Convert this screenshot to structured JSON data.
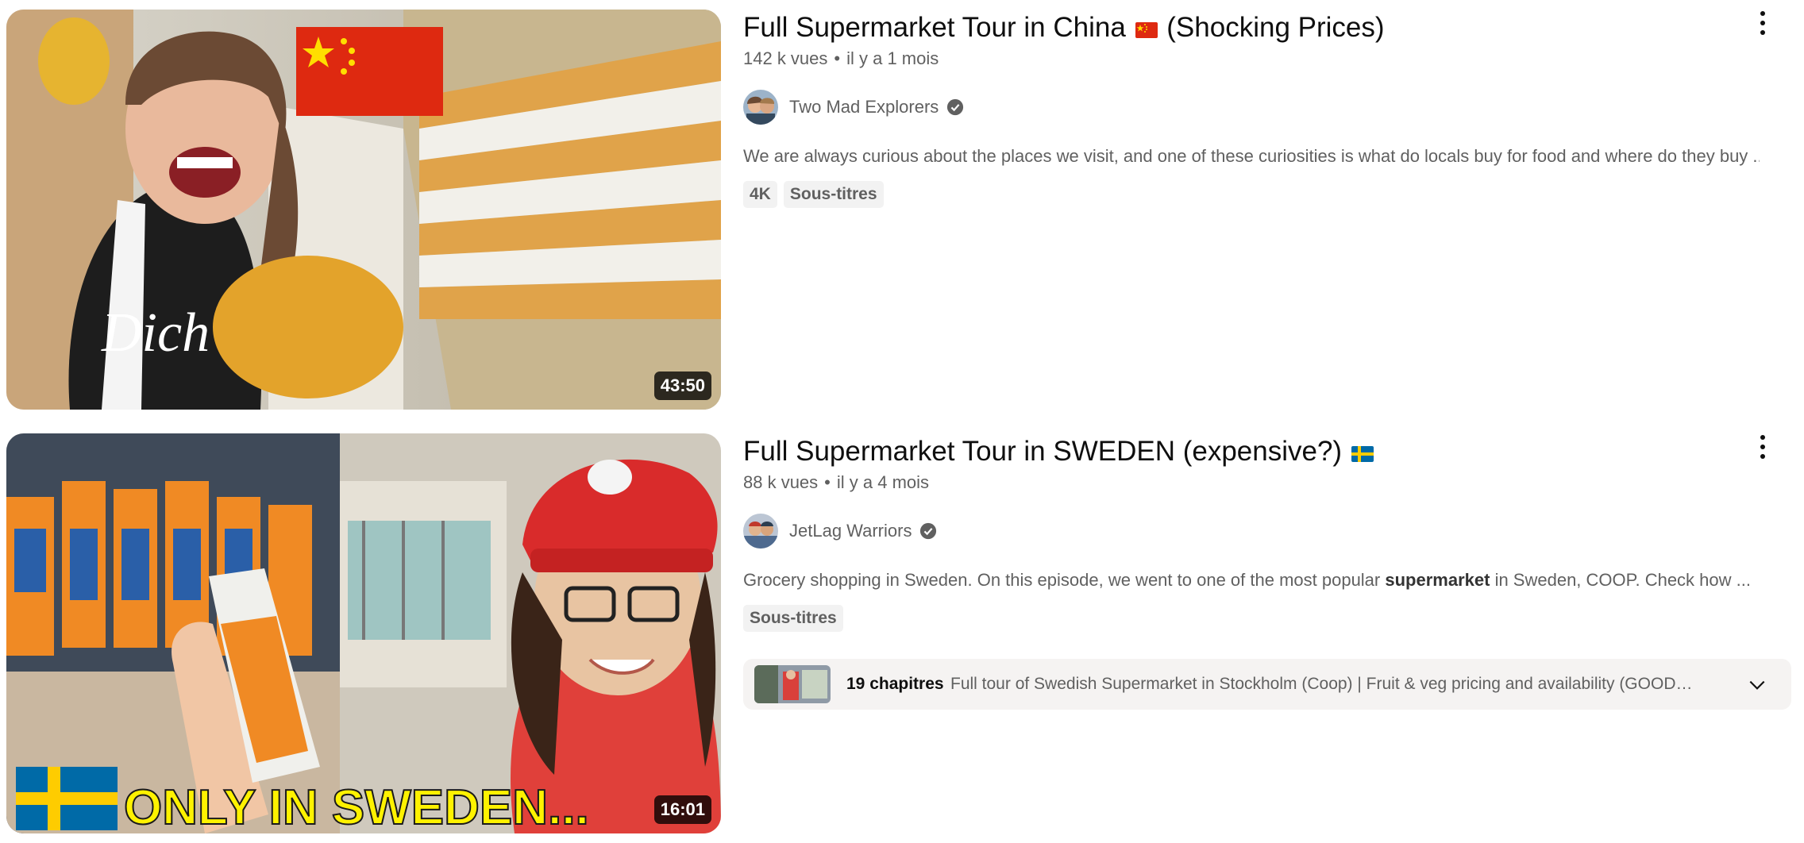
{
  "results": [
    {
      "title": "Full Supermarket Tour in China",
      "title_suffix": "(Shocking Prices)",
      "flag": "china-flag",
      "views": "142 k vues",
      "age": "il y a 1 mois",
      "channel": "Two Mad Explorers",
      "verified_icon": "verified-check-icon",
      "description": "We are always curious about the places we visit, and one of these curiosities is what do locals buy for food and where do they buy ...",
      "badges": [
        "4K",
        "Sous-titres"
      ],
      "duration": "43:50",
      "menu_icon": "more-vert-icon"
    },
    {
      "title": "Full Supermarket Tour in SWEDEN (expensive?)",
      "title_suffix": "",
      "flag": "sweden-flag",
      "views": "88 k vues",
      "age": "il y a 4 mois",
      "channel": "JetLag Warriors",
      "verified_icon": "verified-check-icon",
      "description_pre": "Grocery shopping in Sweden. On this episode, we went to one of the most popular ",
      "description_bold": "supermarket",
      "description_post": " in Sweden, COOP. Check how ...",
      "badges": [
        "Sous-titres"
      ],
      "duration": "16:01",
      "thumbnail_overlay_text": "ONLY IN SWEDEN...",
      "menu_icon": "more-vert-icon",
      "chapters": {
        "count": "19 chapitres",
        "text": "Full tour of Swedish Supermarket in Stockholm (Coop) | Fruit & veg pricing and availability (GOOD…",
        "icon": "chevron-down-icon"
      }
    }
  ],
  "colors": {
    "primary_text": "#0f0f0f",
    "secondary_text": "#606060",
    "badge_bg": "#f2f2f2",
    "chapters_bg": "#f5f3f2",
    "sweden_yellow": "#fff200"
  }
}
